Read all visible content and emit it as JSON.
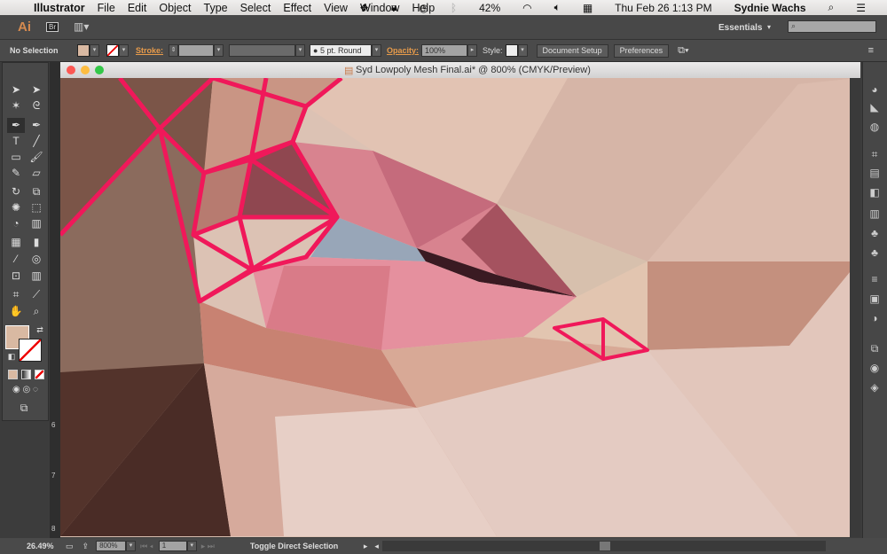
{
  "menubar": {
    "app": "Illustrator",
    "items": [
      "File",
      "Edit",
      "Object",
      "Type",
      "Select",
      "Effect",
      "View",
      "Window",
      "Help"
    ],
    "battery": "42%",
    "datetime": "Thu Feb 26  1:13 PM",
    "user": "Sydnie Wachs"
  },
  "appbar": {
    "logo": "Ai",
    "bridge": "Br",
    "workspace": "Essentials",
    "search_placeholder": ""
  },
  "control": {
    "selection": "No Selection",
    "fill_color": "#d9b9a2",
    "stroke_label": "Stroke:",
    "brush": "5 pt. Round",
    "opacity_label": "Opacity:",
    "opacity": "100%",
    "style_label": "Style:",
    "doc_setup": "Document Setup",
    "preferences": "Preferences"
  },
  "document": {
    "title": "Syd Lowpoly Mesh Final.ai* @ 800% (CMYK/Preview)"
  },
  "ruler": {
    "marks": [
      "6",
      "7",
      "8"
    ]
  },
  "status": {
    "zoom_left": "26.49%",
    "zoom": "800%",
    "artboard": "1",
    "tool_status": "Toggle Direct Selection"
  },
  "colors": {
    "accent_stroke": "#f0185a",
    "fill": "#d9b9a2"
  }
}
